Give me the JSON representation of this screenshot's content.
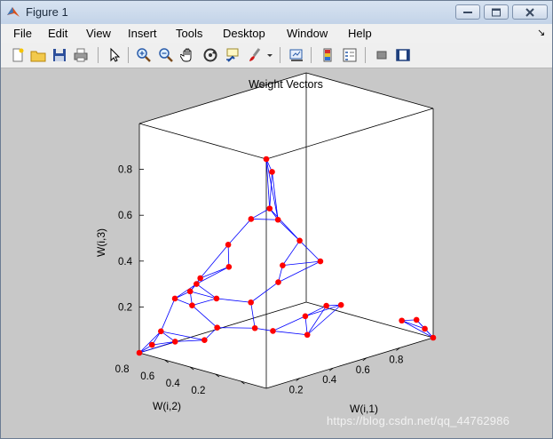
{
  "window": {
    "title": "Figure 1",
    "controls": {
      "minimize": "minimize-icon",
      "maximize": "maximize-icon",
      "close": "close-icon"
    }
  },
  "menu": {
    "items": [
      "File",
      "Edit",
      "View",
      "Insert",
      "Tools",
      "Desktop",
      "Window",
      "Help"
    ],
    "dock_arrow": "↘"
  },
  "toolbar": {
    "icons": [
      "new-figure-icon",
      "open-file-icon",
      "save-icon",
      "print-icon",
      "pointer-icon",
      "zoom-in-icon",
      "zoom-out-icon",
      "pan-hand-icon",
      "rotate-3d-icon",
      "data-cursor-icon",
      "brush-icon",
      "brush-dropdown-icon",
      "link-plot-icon",
      "colorbar-icon",
      "legend-icon",
      "hide-plot-tools-icon",
      "show-plot-tools-icon"
    ]
  },
  "plot": {
    "title": "Weight Vectors",
    "xlabel": "W(i,1)",
    "ylabel": "W(i,2)",
    "zlabel": "W(i,3)",
    "x_ticks": [
      "0.2",
      "0.4",
      "0.6",
      "0.8"
    ],
    "y_ticks": [
      "0.2",
      "0.4",
      "0.6",
      "0.8"
    ],
    "z_ticks": [
      "0.2",
      "0.4",
      "0.6",
      "0.8"
    ],
    "line_color": "#0000ff",
    "marker_color": "#ff0000"
  },
  "chart_data": {
    "type": "scatter",
    "title": "Weight Vectors",
    "xlabel": "W(i,1)",
    "ylabel": "W(i,2)",
    "zlabel": "W(i,3)",
    "xlim": [
      0,
      1
    ],
    "ylim": [
      0,
      1
    ],
    "zlim": [
      0,
      1
    ],
    "grid": false,
    "points": [
      {
        "x": 0.0,
        "y": 0.0,
        "z": 1.0
      },
      {
        "x": 0.05,
        "y": 0.02,
        "z": 0.93
      },
      {
        "x": 0.02,
        "y": 0.0,
        "z": 0.78
      },
      {
        "x": 0.0,
        "y": 0.12,
        "z": 0.72
      },
      {
        "x": 0.07,
        "y": 0.0,
        "z": 0.72
      },
      {
        "x": 0.0,
        "y": 0.3,
        "z": 0.58
      },
      {
        "x": 0.2,
        "y": 0.0,
        "z": 0.6
      },
      {
        "x": 0.0,
        "y": 0.52,
        "z": 0.4
      },
      {
        "x": 0.0,
        "y": 0.55,
        "z": 0.37
      },
      {
        "x": 0.0,
        "y": 0.6,
        "z": 0.33
      },
      {
        "x": 0.0,
        "y": 0.72,
        "z": 0.28
      },
      {
        "x": 0.08,
        "y": 0.4,
        "z": 0.45
      },
      {
        "x": 0.25,
        "y": 0.2,
        "z": 0.45
      },
      {
        "x": 0.05,
        "y": 0.65,
        "z": 0.25
      },
      {
        "x": 0.0,
        "y": 0.9,
        "z": 0.05
      },
      {
        "x": 0.0,
        "y": 0.83,
        "z": 0.12
      },
      {
        "x": 0.12,
        "y": 0.55,
        "z": 0.28
      },
      {
        "x": 0.25,
        "y": 0.45,
        "z": 0.25
      },
      {
        "x": 0.3,
        "y": 0.3,
        "z": 0.35
      },
      {
        "x": 0.4,
        "y": 0.1,
        "z": 0.45
      },
      {
        "x": 0.2,
        "y": 0.65,
        "z": 0.12
      },
      {
        "x": 0.0,
        "y": 1.0,
        "z": 0.0
      },
      {
        "x": 0.1,
        "y": 0.85,
        "z": 0.05
      },
      {
        "x": 0.2,
        "y": 0.75,
        "z": 0.05
      },
      {
        "x": 0.35,
        "y": 0.55,
        "z": 0.1
      },
      {
        "x": 0.5,
        "y": 0.35,
        "z": 0.15
      },
      {
        "x": 0.55,
        "y": 0.25,
        "z": 0.2
      },
      {
        "x": 0.6,
        "y": 0.2,
        "z": 0.2
      },
      {
        "x": 0.85,
        "y": 0.05,
        "z": 0.1
      },
      {
        "x": 0.9,
        "y": 0.0,
        "z": 0.1
      },
      {
        "x": 0.95,
        "y": 0.0,
        "z": 0.05
      },
      {
        "x": 1.0,
        "y": 0.0,
        "z": 0.0
      },
      {
        "x": 0.42,
        "y": 0.5,
        "z": 0.08
      },
      {
        "x": 0.55,
        "y": 0.4,
        "z": 0.05
      }
    ]
  },
  "watermark": "https://blog.csdn.net/qq_44762986"
}
